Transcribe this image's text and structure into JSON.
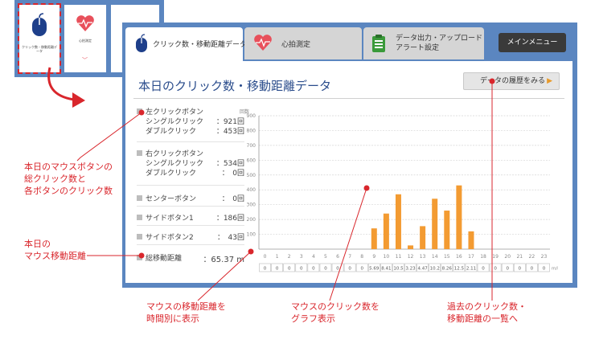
{
  "mini": {
    "card1": "クリック数・移動距離データ",
    "card2": "心拍測定"
  },
  "tabs": [
    {
      "label": "クリック数・移動距離データ",
      "active": true
    },
    {
      "label": "心拍測定",
      "active": false
    },
    {
      "label_line1": "データ出力・アップロード",
      "label_line2": "アラート設定",
      "active": false
    }
  ],
  "menu_button": "メインメニュー",
  "page_title": "本日のクリック数・移動距離データ",
  "history_button": "データの履歴をみる",
  "stats": {
    "left": {
      "title": "左クリックボタン",
      "single_label": "シングルクリック",
      "single_value": "：921回",
      "double_label": "ダブルクリック",
      "double_value": "：453回"
    },
    "right": {
      "title": "右クリックボタン",
      "single_label": "シングルクリック",
      "single_value": "：534回",
      "double_label": "ダブルクリック",
      "double_value": "：　0回"
    },
    "center": {
      "label": "センターボタン",
      "value": "：　0回"
    },
    "side1": {
      "label": "サイドボタン1",
      "value": "：186回"
    },
    "side2": {
      "label": "サイドボタン2",
      "value": "：　43回"
    },
    "distance": {
      "label": "総移動距離",
      "value": "：65.37 m"
    }
  },
  "chart_data": {
    "type": "bar",
    "ylabel": "回数",
    "ylim": [
      0,
      900
    ],
    "yticks": [
      100,
      200,
      300,
      400,
      500,
      600,
      700,
      800,
      900
    ],
    "categories": [
      "0",
      "1",
      "2",
      "3",
      "4",
      "5",
      "6",
      "7",
      "8",
      "9",
      "10",
      "11",
      "12",
      "13",
      "14",
      "15",
      "16",
      "17",
      "18",
      "19",
      "20",
      "21",
      "22",
      "23"
    ],
    "values": [
      0,
      0,
      0,
      0,
      0,
      0,
      0,
      0,
      0,
      140,
      240,
      370,
      25,
      155,
      340,
      260,
      430,
      120,
      0,
      0,
      0,
      0,
      0,
      0
    ],
    "bar_color": "#f39b32",
    "distance_row": [
      "0",
      "0",
      "0",
      "0",
      "0",
      "0",
      "0",
      "0",
      "0",
      "5.69",
      "8.41",
      "10.5",
      "3.23",
      "4.47",
      "10.2",
      "8.26",
      "12.5",
      "2.11",
      "0",
      "0",
      "0",
      "0",
      "0",
      "0"
    ],
    "distance_unit": "m/h"
  },
  "annotations": {
    "a1": [
      "本日のマウスボタンの",
      "総クリック数と",
      "各ボタンのクリック数"
    ],
    "a2": [
      "本日の",
      "マウス移動距離"
    ],
    "a3": [
      "マウスの移動距離を",
      "時間別に表示"
    ],
    "a4": [
      "マウスのクリック数を",
      "グラフ表示"
    ],
    "a5": [
      "過去のクリック数・",
      "移動距離の一覧へ"
    ]
  },
  "colors": {
    "window": "#5b86c0",
    "annotation": "#d9262c",
    "bar": "#f39b32",
    "title": "#2b4d8c"
  }
}
